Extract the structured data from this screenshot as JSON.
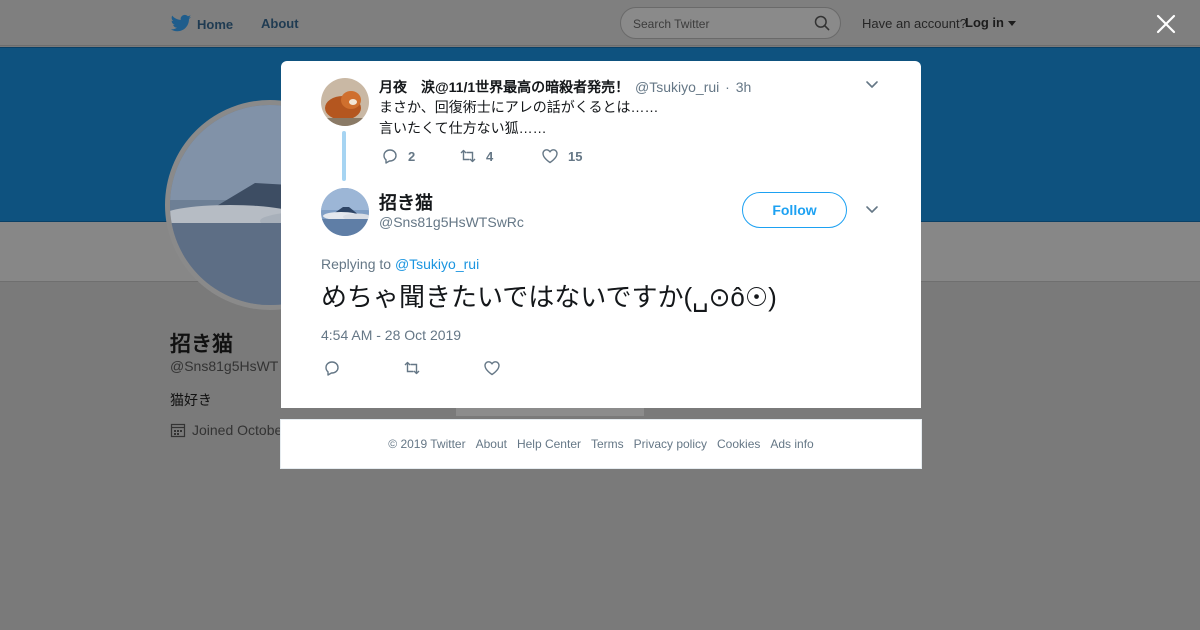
{
  "topbar": {
    "home_label": "Home",
    "about_label": "About",
    "search_placeholder": "Search Twitter",
    "account_prompt": "Have an account?",
    "login_label": "Log in",
    "icons": {
      "logo": "twitter-bird-icon",
      "search": "search-icon",
      "login_caret": "caret-down-icon",
      "close": "close-icon"
    }
  },
  "background_profile": {
    "name": "招き猫",
    "handle": "@Sns81g5HsWT",
    "bio": "猫好き",
    "joined": "Joined Octobe",
    "banner_color": "#0e527f"
  },
  "parent_tweet": {
    "name": "月夜　涙@11/1世界最高の暗殺者発売！",
    "handle": "@Tsukiyo_rui",
    "separator": "·",
    "time": "3h",
    "lines": [
      "まさか、回復術士にアレの話がくるとは……",
      "言いたくて仕方ない狐……"
    ],
    "reply_count": "2",
    "retweet_count": "4",
    "like_count": "15"
  },
  "main_tweet": {
    "name": "招き猫",
    "handle": "@Sns81g5HsWTSwRc",
    "follow_label": "Follow",
    "replying_prefix": "Replying to ",
    "replying_handle": "@Tsukiyo_rui",
    "text": "めちゃ聞きたいではないですか(␣⊙ô☉)",
    "timestamp": "4:54 AM - 28 Oct 2019"
  },
  "footer": {
    "links": [
      "© 2019 Twitter",
      "About",
      "Help Center",
      "Terms",
      "Privacy policy",
      "Cookies",
      "Ads info"
    ]
  },
  "colors": {
    "accent": "#1da1f2",
    "thread_line": "#a6d4f2",
    "muted": "#657786"
  }
}
